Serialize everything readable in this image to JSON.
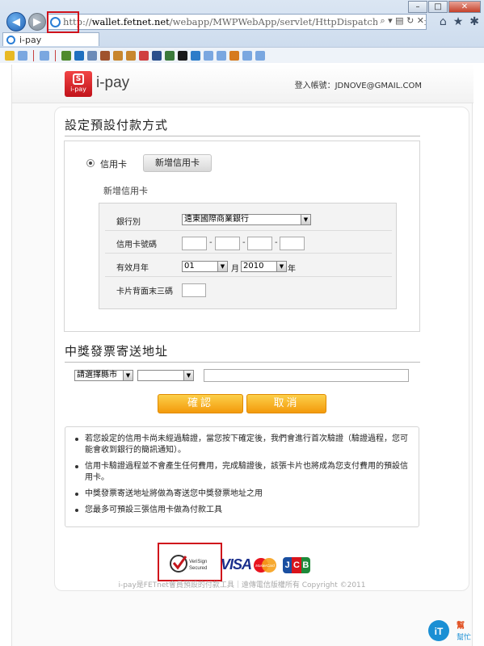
{
  "browser": {
    "url_scheme": "http://",
    "url_host": "wallet.fetnet.net",
    "url_path": "/webapp/MWPWebApp/servlet/HttpDispatcher/WEBConfigBroker/",
    "tab_title": "i-pay",
    "window_buttons": [
      "–",
      "□",
      "✕"
    ],
    "toolbar_icons": [
      "home-icon",
      "star-icon",
      "gear-icon"
    ],
    "accent_color": "#1e5fb3"
  },
  "header": {
    "logo_text": "i-pay",
    "logo_badge": "i-pay",
    "logo_symbol": "S",
    "login": "登入帳號：JDNOVE@GMAIL.COM"
  },
  "payment": {
    "section_title": "設定預設付款方式",
    "radio_label": "信用卡",
    "add_button": "新增信用卡",
    "sub_label": "新增信用卡",
    "bank_label": "銀行別",
    "bank_value": "遠東國際商業銀行",
    "card_label": "信用卡號碼",
    "expiry_label": "有效月年",
    "month_value": "01",
    "month_unit": "月",
    "year_value": "2010",
    "year_unit": "年",
    "cvv_label": "卡片背面末三碼"
  },
  "invoice": {
    "section_title": "中獎發票寄送地址",
    "city_value": "請選擇縣市",
    "district_value": ""
  },
  "actions": {
    "confirm": "確認",
    "cancel": "取消",
    "button_color": "#f39a0b"
  },
  "notes": [
    "若您設定的信用卡尚未經過驗證，當您按下確定後，我們會進行首次驗證（驗證過程，您可能會收到銀行的簡訊通知）。",
    "信用卡驗證過程並不會產生任何費用，完成驗證後，該張卡片也將成為您支付費用的預設信用卡。",
    "中獎發票寄送地址將做為寄送您中獎發票地址之用",
    "您最多可預設三張信用卡做為付款工具"
  ],
  "footer": {
    "verisign_line1": "VeriSign",
    "verisign_line2": "Secured",
    "visa": "VISA",
    "mastercard": "MasterCard",
    "jcb": [
      "J",
      "C",
      "B"
    ],
    "copyright": "i-pay是FETnet會員預設的付款工具｜遠傳電信版權所有 Copyright ©2011"
  },
  "watermark": {
    "line1": "iT",
    "line2": "幫",
    "line3": "幫忙"
  }
}
